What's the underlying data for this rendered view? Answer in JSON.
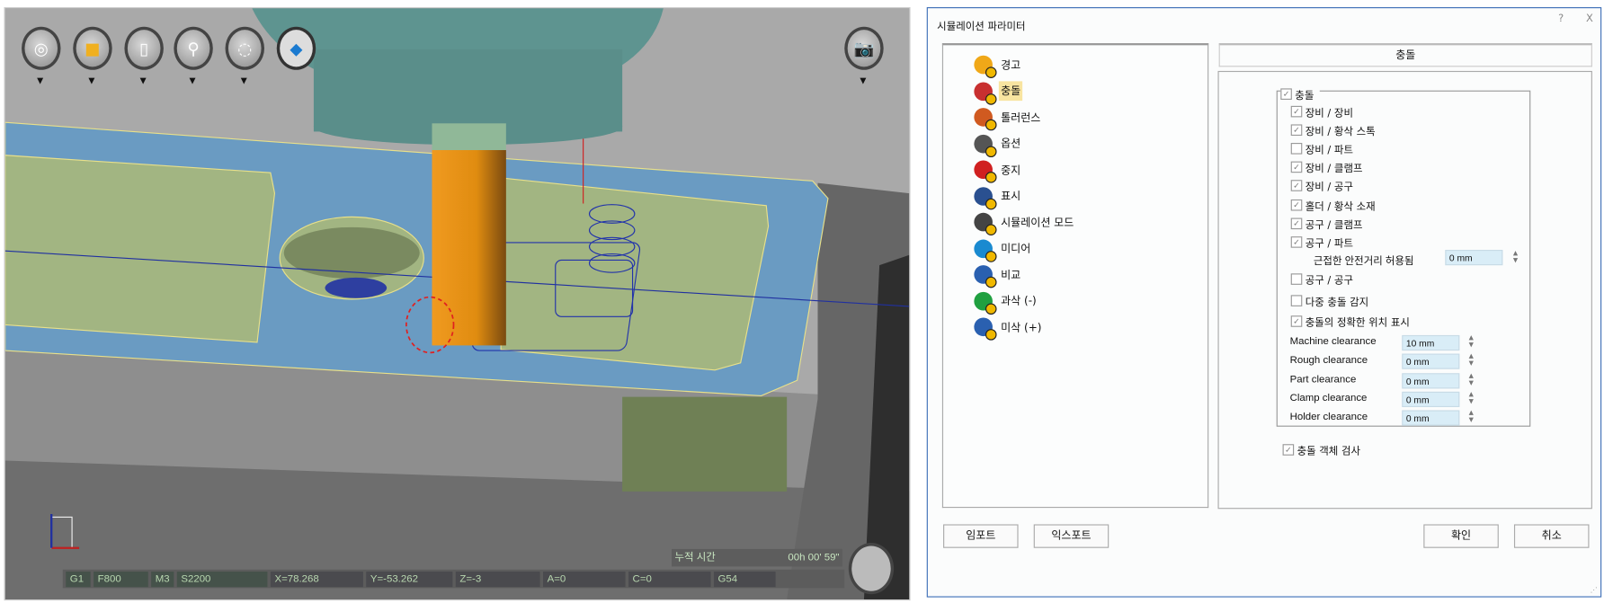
{
  "viewport": {
    "toolbar": [
      {
        "name": "view-orientation",
        "icon": "view-cube-icon"
      },
      {
        "name": "display-mode",
        "icon": "cube-icon"
      },
      {
        "name": "stock-display",
        "icon": "cylinder-icon"
      },
      {
        "name": "zoom",
        "icon": "magnifier-icon"
      },
      {
        "name": "selection-clear",
        "icon": "dashed-circle-x-icon"
      },
      {
        "name": "rotate",
        "icon": "rotate-icon"
      }
    ],
    "right_tool": {
      "icon": "camera-icon"
    },
    "accumulated_time_label": "누적 시간",
    "accumulated_time_value": "00h 00' 59\"",
    "status": {
      "g_code": "G1",
      "feed": "F800",
      "m_code": "M3",
      "spindle": "S2200",
      "x": "X=78.268",
      "y": "Y=-53.262",
      "z": "Z=-3",
      "a": "A=0",
      "c": "C=0",
      "wcs": "G54"
    }
  },
  "dialog": {
    "title": "시뮬레이션 파라미터",
    "help": "?",
    "close": "X",
    "tree": [
      {
        "label": "경고",
        "color": "#f0a818"
      },
      {
        "label": "충돌",
        "color": "#c83030",
        "selected": true
      },
      {
        "label": "톨러런스",
        "color": "#d05a20"
      },
      {
        "label": "옵션",
        "color": "#555"
      },
      {
        "label": "중지",
        "color": "#d02020"
      },
      {
        "label": "표시",
        "color": "#2a5090"
      },
      {
        "label": "시뮬레이션 모드",
        "color": "#444"
      },
      {
        "label": "미디어",
        "color": "#1a8ad0"
      },
      {
        "label": "비교",
        "color": "#2a60b0"
      },
      {
        "label": "과삭 (-)",
        "color": "#20a040"
      },
      {
        "label": "미삭 (+)",
        "color": "#2a60b0"
      }
    ],
    "section_header": "충돌",
    "group_label": "충돌",
    "group_checked": true,
    "checks": [
      {
        "label": "장비 / 장비",
        "checked": true
      },
      {
        "label": "장비 / 황삭 스톡",
        "checked": true
      },
      {
        "label": "장비 / 파트",
        "checked": false
      },
      {
        "label": "장비 / 클램프",
        "checked": true
      },
      {
        "label": "장비 / 공구",
        "checked": true
      },
      {
        "label": "홀더 / 황삭 소재",
        "checked": true
      },
      {
        "label": "공구 / 클램프",
        "checked": true
      },
      {
        "label": "공구 / 파트",
        "checked": true
      }
    ],
    "tolerance_label": "근접한 안전거리 허용됨",
    "tolerance_value": "0 mm",
    "checks2": [
      {
        "label": "공구 / 공구",
        "checked": false
      },
      {
        "label": "다중 충돌 감지",
        "checked": false
      },
      {
        "label": "충돌의 정확한 위치 표시",
        "checked": true
      }
    ],
    "clearances": [
      {
        "label": "Machine clearance",
        "value": "10 mm"
      },
      {
        "label": "Rough clearance",
        "value": "0 mm"
      },
      {
        "label": "Part clearance",
        "value": "0 mm"
      },
      {
        "label": "Clamp clearance",
        "value": "0 mm"
      },
      {
        "label": "Holder clearance",
        "value": "0 mm"
      }
    ],
    "object_check": {
      "label": "충돌 객체 검사",
      "checked": true
    },
    "buttons": {
      "import": "임포트",
      "export": "익스포트",
      "ok": "확인",
      "cancel": "취소"
    }
  }
}
